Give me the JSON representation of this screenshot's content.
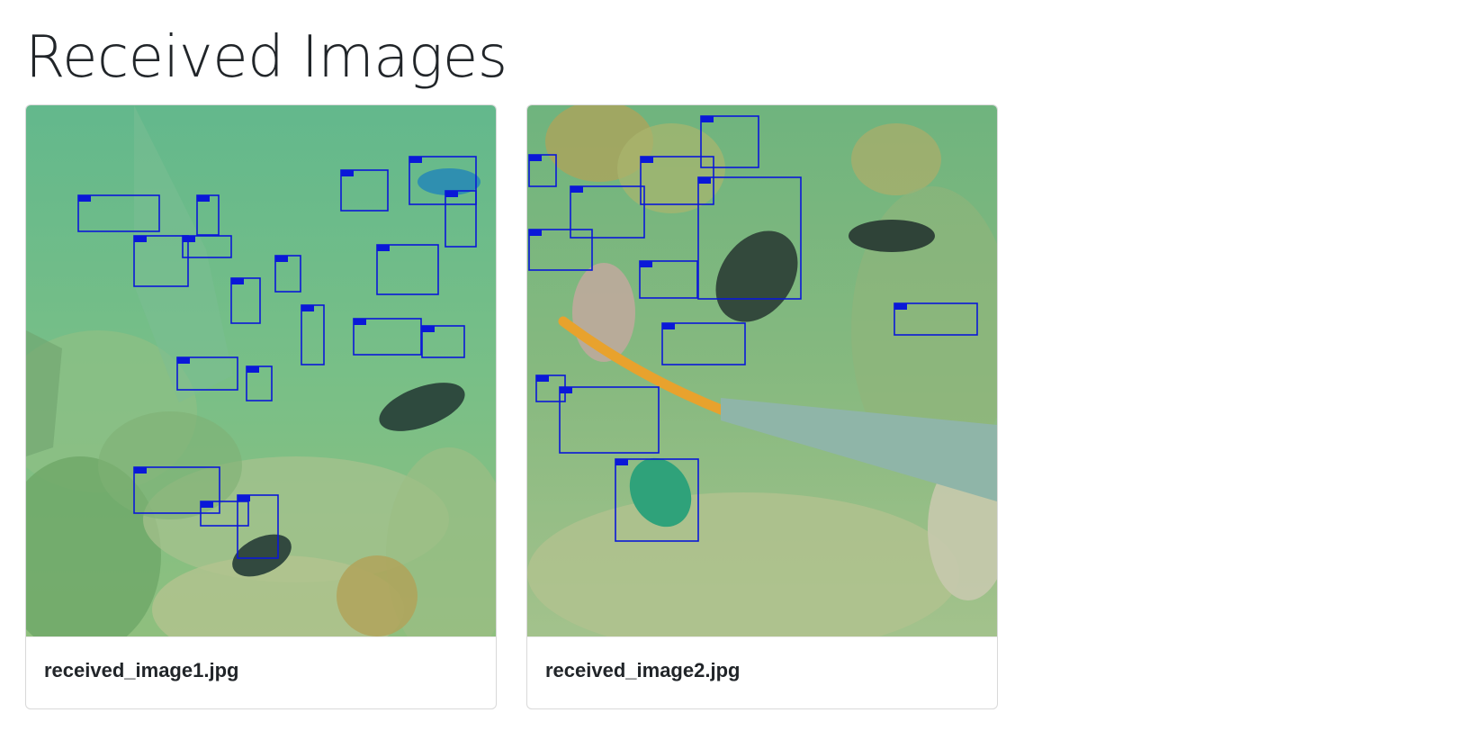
{
  "page": {
    "title": "Received Images"
  },
  "gallery": {
    "cards": [
      {
        "caption": "received_image1.jpg",
        "detection_label": "fish",
        "detection_count": 18
      },
      {
        "caption": "received_image2.jpg",
        "detection_label": "fish",
        "detection_count": 12
      }
    ]
  },
  "colors": {
    "detection_box": "#0a18d8",
    "water": "#5fb483",
    "card_border": "#dfe1e4",
    "text": "#212529"
  }
}
